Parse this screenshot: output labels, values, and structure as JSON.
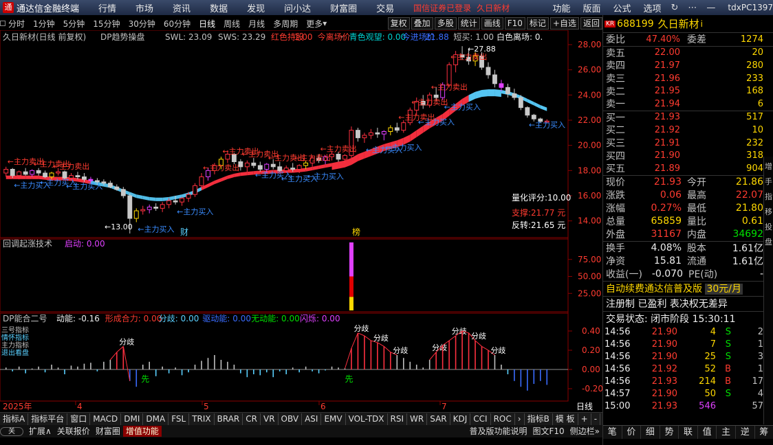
{
  "menubar": {
    "app_title": "通达信金融终端",
    "items": [
      "行情",
      "市场",
      "资讯",
      "数据",
      "发现",
      "问小达",
      "财富圈",
      "交易"
    ],
    "promo1": "国信证券已登录",
    "promo2": "久日新材",
    "right_items": [
      "功能",
      "版面",
      "公式",
      "选项"
    ],
    "user": "tdxPC1397"
  },
  "timeframes": [
    "分时",
    "1分钟",
    "5分钟",
    "15分钟",
    "30分钟",
    "60分钟",
    "日线",
    "周线",
    "月线",
    "多周期",
    "更多"
  ],
  "active_timeframe": "日线",
  "tools": [
    "复权",
    "叠加",
    "多股",
    "统计",
    "画线",
    "F10",
    "标记",
    "+自选",
    "返回"
  ],
  "main_chart": {
    "title_line": "久日新材(日线 前复权)",
    "indicator_name": "DP趋势操盘",
    "params": [
      {
        "label": "SWL: 23.09",
        "color": "#c0c0c0"
      },
      {
        "label": "SWS: 23.29",
        "color": "#c0c0c0"
      },
      {
        "label": "红色持股",
        "color": "#ff3b30"
      },
      {
        "label": "1.00",
        "color": "#ff3b30"
      },
      {
        "label": "今离场价",
        "color": "#ff3b30"
      },
      {
        "label": "·",
        "color": "#c0c0c0"
      },
      {
        "label": "青色观望: 0.00",
        "color": "#00d0d0"
      },
      {
        "label": "今进场价",
        "color": "#3a6cff"
      },
      {
        "label": "21.88",
        "color": "#3a6cff"
      },
      {
        "label": "短买: 1.00",
        "color": "#c0c0c0"
      },
      {
        "label": "白色离场: 0.",
        "color": "#eee"
      }
    ],
    "y_ticks": [
      "28.00",
      "26.00",
      "24.00",
      "22.00",
      "20.00",
      "18.00",
      "16.00",
      "14.00"
    ],
    "labels": {
      "high": "27.88",
      "low": "13.00",
      "score": "量化评分:10.00",
      "support": "支撑:21.77 元",
      "reversal": "反转:21.65 元",
      "cai": "财",
      "bang": "榜",
      "buy": "主力买入",
      "sell": "主力卖出"
    }
  },
  "sub1": {
    "title": "回调起涨技术",
    "param": "启动: 0.00",
    "y_ticks": [
      "75.00",
      "50.00",
      "25.00"
    ]
  },
  "sub2": {
    "title": "DP能合二号",
    "params": [
      {
        "label": "动能: -0.16",
        "color": "#eee"
      },
      {
        "label": "形成合力: 0.00",
        "color": "#ff3b30"
      },
      {
        "label": "分歧: 0.00",
        "color": "#5ad0ff"
      },
      {
        "label": "驱动能: 0.00",
        "color": "#3a6cff"
      },
      {
        "label": "无动能: 0.00",
        "color": "#00e000"
      },
      {
        "label": "闪烁: 0.00",
        "color": "#e040ff"
      }
    ],
    "y_ticks": [
      "0.40",
      "0.20",
      "0.00",
      "-0.20"
    ],
    "left_tags": [
      "三号指标",
      "情怀指标",
      "主力指标",
      "退出看盘"
    ],
    "fenqi": "分歧",
    "xian": "先"
  },
  "x_labels": [
    "2025年",
    "4",
    "5",
    "6",
    "7"
  ],
  "period_label": "日线",
  "bottom_tabs": [
    "指标A",
    "指标平台",
    "窗口",
    "MACD",
    "DMI",
    "DMA",
    "FSL",
    "TRIX",
    "BRAR",
    "CR",
    "VR",
    "OBV",
    "ASI",
    "EMV",
    "VOL-TDX",
    "RSI",
    "WR",
    "SAR",
    "KDJ",
    "CCI",
    "ROC"
  ],
  "bottom_right": [
    "指标B",
    "模 板",
    "+",
    "-"
  ],
  "bottom_row2": {
    "toggle": "关",
    "items": [
      "扩展∧",
      "关联报价",
      "财富圈"
    ],
    "highlight": "增值功能",
    "right": [
      "普及版功能说明",
      "图文F10",
      "侧边栏»"
    ]
  },
  "quote": {
    "tag": "KR",
    "code": "688199",
    "name": "久日新材",
    "ind": "i",
    "weibi": {
      "label": "委比",
      "value": "47.40%",
      "label2": "委差",
      "value2": "1274"
    },
    "asks": [
      {
        "label": "卖五",
        "price": "22.00",
        "vol": "20"
      },
      {
        "label": "卖四",
        "price": "21.97",
        "vol": "280"
      },
      {
        "label": "卖三",
        "price": "21.96",
        "vol": "233"
      },
      {
        "label": "卖二",
        "price": "21.95",
        "vol": "168"
      },
      {
        "label": "卖一",
        "price": "21.94",
        "vol": "6"
      }
    ],
    "bids": [
      {
        "label": "买一",
        "price": "21.93",
        "vol": "517"
      },
      {
        "label": "买二",
        "price": "21.92",
        "vol": "10"
      },
      {
        "label": "买三",
        "price": "21.91",
        "vol": "232"
      },
      {
        "label": "买四",
        "price": "21.90",
        "vol": "318"
      },
      {
        "label": "买五",
        "price": "21.89",
        "vol": "904"
      }
    ],
    "stats": [
      {
        "k": "现价",
        "v": "21.93",
        "vc": "red",
        "k2": "今开",
        "v2": "21.86",
        "v2c": "yel"
      },
      {
        "k": "涨跌",
        "v": "0.06",
        "vc": "red",
        "k2": "最高",
        "v2": "22.07",
        "v2c": "red"
      },
      {
        "k": "涨幅",
        "v": "0.27%",
        "vc": "red",
        "k2": "最低",
        "v2": "21.80",
        "v2c": "yel"
      },
      {
        "k": "总量",
        "v": "65859",
        "vc": "yel",
        "k2": "量比",
        "v2": "0.61",
        "v2c": "yel"
      },
      {
        "k": "外盘",
        "v": "31167",
        "vc": "red",
        "k2": "内盘",
        "v2": "34692",
        "v2c": "grn"
      }
    ],
    "stats2": [
      {
        "k": "换手",
        "v": "4.08%",
        "k2": "股本",
        "v2": "1.61亿"
      },
      {
        "k": "净资",
        "v": "15.81",
        "k2": "流通",
        "v2": "1.61亿"
      },
      {
        "k": "收益(一)",
        "v": "-0.070",
        "k2": "PE(动)",
        "v2": "-"
      }
    ],
    "ad1": "自动续费通达信普及版",
    "ad1b": "30元/月",
    "ad2": "注册制 已盈利 表决权无差异",
    "status": "交易状态: 闭市阶段 15:30:11",
    "ticks": [
      {
        "t": "14:56",
        "p": "21.90",
        "v": "4",
        "s": "S",
        "n": "2"
      },
      {
        "t": "14:56",
        "p": "21.90",
        "v": "7",
        "s": "S",
        "n": "1"
      },
      {
        "t": "14:56",
        "p": "21.90",
        "v": "25",
        "s": "S",
        "n": "3"
      },
      {
        "t": "14:56",
        "p": "21.92",
        "v": "52",
        "s": "B",
        "n": "1"
      },
      {
        "t": "14:56",
        "p": "21.93",
        "v": "214",
        "s": "B",
        "n": "17"
      },
      {
        "t": "14:57",
        "p": "21.90",
        "v": "50",
        "s": "S",
        "n": "4"
      },
      {
        "t": "15:00",
        "p": "21.93",
        "v": "546",
        "s": "",
        "n": "57"
      }
    ],
    "tabs": [
      "笔",
      "价",
      "细",
      "势",
      "联",
      "值",
      "主",
      "逆",
      "筹"
    ],
    "side": [
      "增",
      "手",
      "指",
      "移",
      "投",
      "盘"
    ]
  },
  "chart_data": {
    "type": "candlestick",
    "title": "久日新材(日线 前复权)",
    "ylim": [
      13,
      28.6
    ],
    "ohlc": [
      [
        17.8,
        18.3,
        17.5,
        18.1
      ],
      [
        18.1,
        18.2,
        17.4,
        17.6
      ],
      [
        17.6,
        18.0,
        17.3,
        17.9
      ],
      [
        17.9,
        18.2,
        17.6,
        17.7
      ],
      [
        17.7,
        18.1,
        17.5,
        18.0
      ],
      [
        18.0,
        18.2,
        17.6,
        17.8
      ],
      [
        17.8,
        18.0,
        17.4,
        17.5
      ],
      [
        17.5,
        17.9,
        17.3,
        17.8
      ],
      [
        17.8,
        18.2,
        17.6,
        17.9
      ],
      [
        17.9,
        18.0,
        17.3,
        17.4
      ],
      [
        17.4,
        17.8,
        17.2,
        17.6
      ],
      [
        17.6,
        17.9,
        17.3,
        17.5
      ],
      [
        17.5,
        17.8,
        17.1,
        17.3
      ],
      [
        17.3,
        17.5,
        17.0,
        17.2
      ],
      [
        17.2,
        17.4,
        16.9,
        17.1
      ],
      [
        17.1,
        17.3,
        16.8,
        17.0
      ],
      [
        17.0,
        17.2,
        16.6,
        16.7
      ],
      [
        16.7,
        16.9,
        16.4,
        16.5
      ],
      [
        16.5,
        16.7,
        15.8,
        16.0
      ],
      [
        16.0,
        16.2,
        13.0,
        14.2
      ],
      [
        14.2,
        15.0,
        13.9,
        14.8
      ],
      [
        14.8,
        15.2,
        14.5,
        14.9
      ],
      [
        14.9,
        15.3,
        14.6,
        15.1
      ],
      [
        15.1,
        15.4,
        14.8,
        15.0
      ],
      [
        15.0,
        15.5,
        14.7,
        15.3
      ],
      [
        15.3,
        15.8,
        15.0,
        15.6
      ],
      [
        15.6,
        16.0,
        15.3,
        15.5
      ],
      [
        15.5,
        15.9,
        15.2,
        15.8
      ],
      [
        15.8,
        16.3,
        15.5,
        16.1
      ],
      [
        16.1,
        17.0,
        15.9,
        16.8
      ],
      [
        16.8,
        17.8,
        16.6,
        17.5
      ],
      [
        17.5,
        18.2,
        17.2,
        18.0
      ],
      [
        18.0,
        18.6,
        17.7,
        18.4
      ],
      [
        18.4,
        19.1,
        18.1,
        18.9
      ],
      [
        18.9,
        19.6,
        18.6,
        19.3
      ],
      [
        19.3,
        19.4,
        18.5,
        18.7
      ],
      [
        18.7,
        18.9,
        18.0,
        18.3
      ],
      [
        18.3,
        18.8,
        17.9,
        18.6
      ],
      [
        18.6,
        19.0,
        18.2,
        18.4
      ],
      [
        18.4,
        18.7,
        17.9,
        18.1
      ],
      [
        18.1,
        18.6,
        17.8,
        18.5
      ],
      [
        18.5,
        18.9,
        18.1,
        18.3
      ],
      [
        18.3,
        18.7,
        17.9,
        18.0
      ],
      [
        18.0,
        18.4,
        17.8,
        18.2
      ],
      [
        18.2,
        18.6,
        17.9,
        18.1
      ],
      [
        18.1,
        18.5,
        17.8,
        18.4
      ],
      [
        18.4,
        18.8,
        18.1,
        18.6
      ],
      [
        18.6,
        19.2,
        18.3,
        19.0
      ],
      [
        19.0,
        19.3,
        18.6,
        18.8
      ],
      [
        18.8,
        19.2,
        18.5,
        19.1
      ],
      [
        19.1,
        19.6,
        18.8,
        19.3
      ],
      [
        19.3,
        19.5,
        18.7,
        18.9
      ],
      [
        18.9,
        19.3,
        18.6,
        19.2
      ],
      [
        19.2,
        21.5,
        19.0,
        21.2
      ],
      [
        21.2,
        21.4,
        20.3,
        20.6
      ],
      [
        20.6,
        21.0,
        20.2,
        20.8
      ],
      [
        20.8,
        21.3,
        20.5,
        21.0
      ],
      [
        21.0,
        21.4,
        20.6,
        20.9
      ],
      [
        20.9,
        21.2,
        20.4,
        21.1
      ],
      [
        21.1,
        21.6,
        20.8,
        21.4
      ],
      [
        21.4,
        21.8,
        21.0,
        21.2
      ],
      [
        21.2,
        22.0,
        21.0,
        21.8
      ],
      [
        21.8,
        23.0,
        21.6,
        22.8
      ],
      [
        22.8,
        23.8,
        22.4,
        23.5
      ],
      [
        23.5,
        24.0,
        22.9,
        23.2
      ],
      [
        23.2,
        24.2,
        23.0,
        24.0
      ],
      [
        24.0,
        24.6,
        23.5,
        23.8
      ],
      [
        23.8,
        25.0,
        23.6,
        24.8
      ],
      [
        24.8,
        26.6,
        24.6,
        26.4
      ],
      [
        26.4,
        27.5,
        25.8,
        27.2
      ],
      [
        27.2,
        27.88,
        26.8,
        27.0
      ],
      [
        27.0,
        27.6,
        26.4,
        26.7
      ],
      [
        26.7,
        27.4,
        26.3,
        27.1
      ],
      [
        27.1,
        27.4,
        26.0,
        26.2
      ],
      [
        26.2,
        26.6,
        25.3,
        25.6
      ],
      [
        25.6,
        26.0,
        24.6,
        24.9
      ],
      [
        24.9,
        25.2,
        24.3,
        24.6
      ],
      [
        24.6,
        24.9,
        23.8,
        24.1
      ],
      [
        24.1,
        24.5,
        23.6,
        23.8
      ],
      [
        23.8,
        24.0,
        22.8,
        23.0
      ],
      [
        23.0,
        23.1,
        22.2,
        22.4
      ],
      [
        22.4,
        22.5,
        21.9,
        22.1
      ],
      [
        22.1,
        22.2,
        21.8,
        21.9
      ],
      [
        21.9,
        22.07,
        21.8,
        21.93
      ]
    ],
    "trend_band": [
      17.6,
      17.6,
      17.6,
      17.6,
      17.6,
      17.6,
      17.55,
      17.5,
      17.5,
      17.5,
      17.45,
      17.4,
      17.3,
      17.2,
      17.1,
      17.0,
      16.9,
      16.7,
      16.5,
      16.3,
      16.1,
      16.0,
      15.9,
      15.85,
      15.85,
      15.9,
      16.0,
      16.1,
      16.25,
      16.45,
      16.7,
      16.95,
      17.2,
      17.4,
      17.6,
      17.75,
      17.85,
      17.9,
      17.95,
      18.0,
      18.0,
      18.05,
      18.05,
      18.1,
      18.1,
      18.15,
      18.2,
      18.3,
      18.4,
      18.5,
      18.6,
      18.7,
      18.8,
      19.0,
      19.3,
      19.5,
      19.7,
      19.9,
      20.1,
      20.25,
      20.4,
      20.6,
      20.85,
      21.2,
      21.55,
      21.9,
      22.2,
      22.5,
      22.9,
      23.3,
      23.7,
      24.0,
      24.25,
      24.4,
      24.45,
      24.45,
      24.4,
      24.3,
      24.15,
      23.95,
      23.7,
      23.45,
      23.2,
      23.0
    ],
    "ind1": [
      {
        "bar": 53,
        "segments": [
          [
            0,
            20,
            "#ffd800"
          ],
          [
            20,
            50,
            "#e00000"
          ],
          [
            50,
            100,
            "#e040ff"
          ]
        ]
      }
    ],
    "ind2": [
      0.02,
      -0.02,
      0.03,
      -0.04,
      0.01,
      0.03,
      -0.03,
      0.05,
      0.02,
      -0.05,
      0.04,
      0.03,
      0.06,
      0.07,
      -0.02,
      0.08,
      0.1,
      0.18,
      0.24,
      -0.12,
      -0.18,
      0.05,
      0.08,
      -0.07,
      0.03,
      -0.04,
      0.02,
      -0.06,
      -0.03,
      0.05,
      0.09,
      0.12,
      0.15,
      0.1,
      0.08,
      0.05,
      -0.04,
      -0.08,
      -0.05,
      -0.06,
      -0.03,
      -0.08,
      -0.02,
      -0.05,
      0.02,
      -0.03,
      0.03,
      -0.02,
      -0.04,
      -0.01,
      0.03,
      0.02,
      0.01,
      0.22,
      0.38,
      0.35,
      0.3,
      0.28,
      0.24,
      0.18,
      0.15,
      0.12,
      0.08,
      0.05,
      0.02,
      0.1,
      0.18,
      0.25,
      0.3,
      0.35,
      0.4,
      0.38,
      0.3,
      0.24,
      0.2,
      0.15,
      0.05,
      -0.05,
      -0.12,
      -0.18,
      -0.22,
      -0.15,
      -0.12,
      -0.16
    ]
  }
}
